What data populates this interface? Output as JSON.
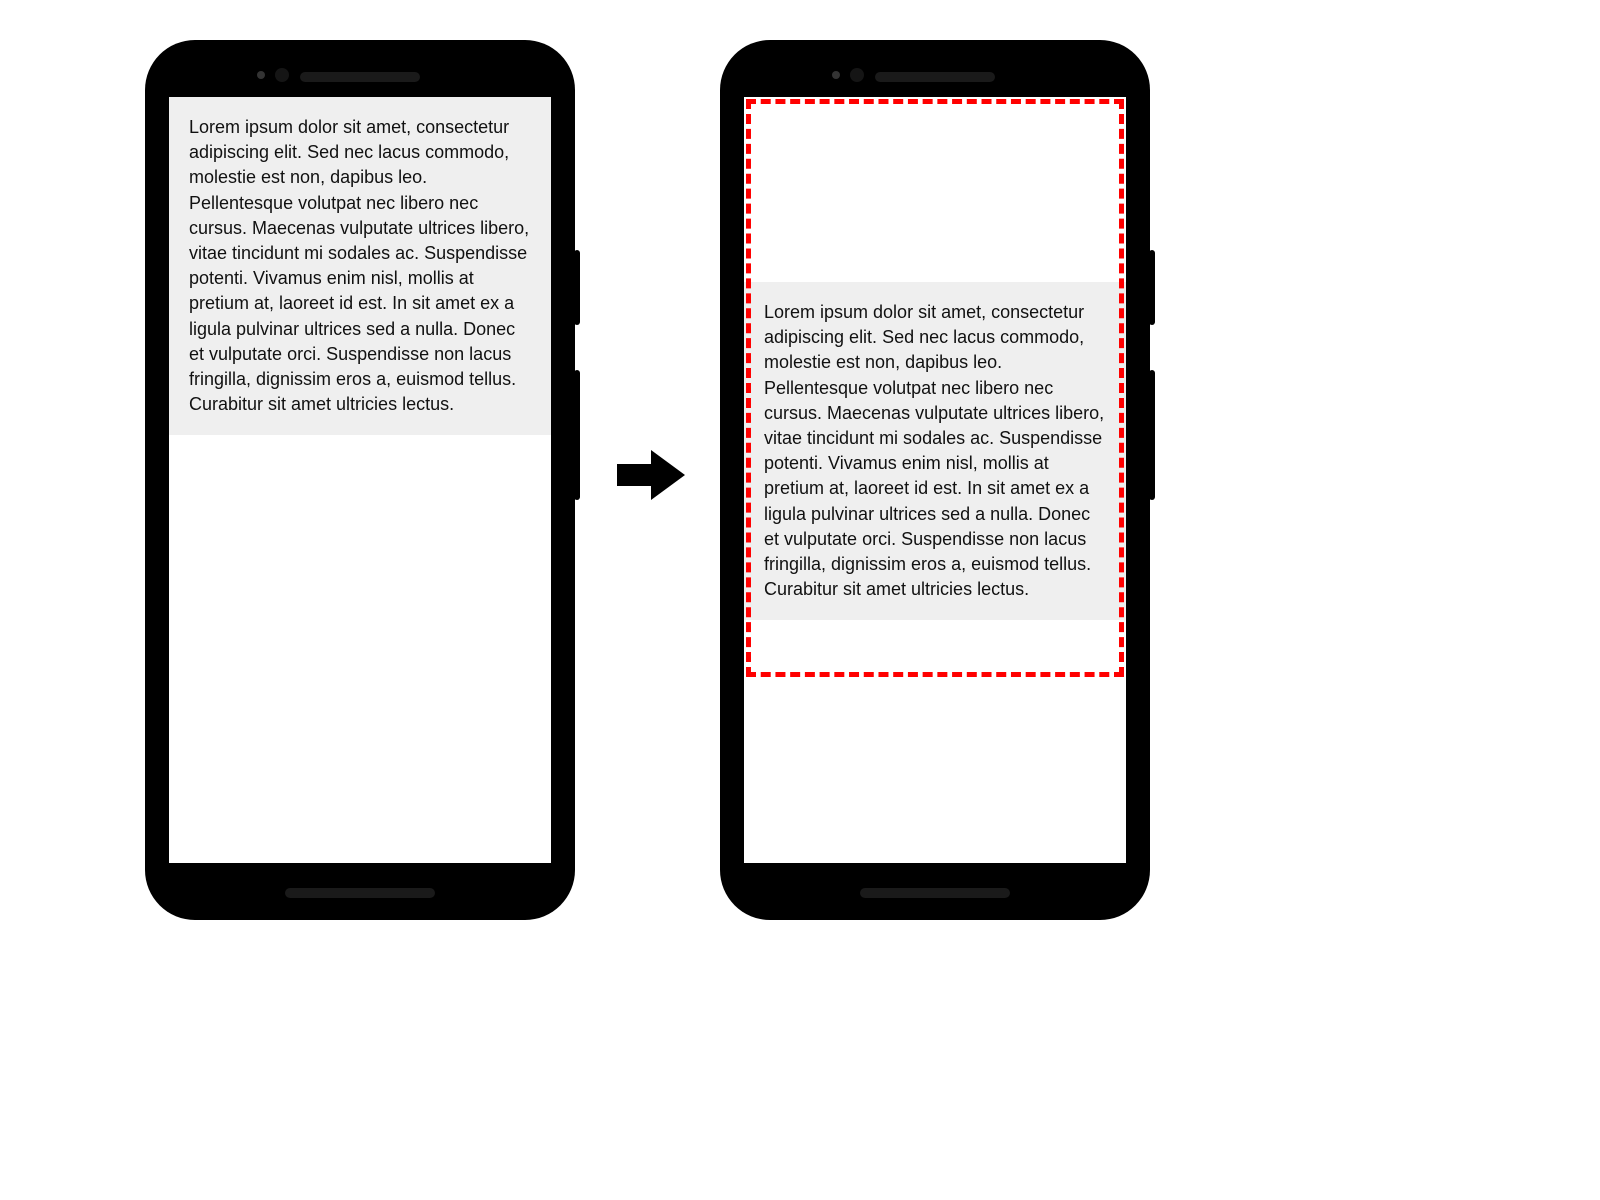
{
  "lorem_text": "Lorem ipsum dolor sit amet, consectetur adipiscing elit. Sed nec lacus commodo, molestie est non, dapibus leo. Pellentesque volutpat nec libero nec cursus. Maecenas vulputate ultrices libero, vitae tincidunt mi sodales ac. Suspendisse potenti. Vivamus enim nisl, mollis at pretium at, laoreet id est. In sit amet ex a ligula pulvinar ultrices sed a nulla. Donec et vulputate orci. Suspendisse non lacus fringilla, dignissim eros a, euismod tellus. Curabitur sit amet ultricies lectus.",
  "colors": {
    "highlight_border": "#ff0000",
    "text_block_bg": "#efefef",
    "phone_frame": "#000000"
  }
}
